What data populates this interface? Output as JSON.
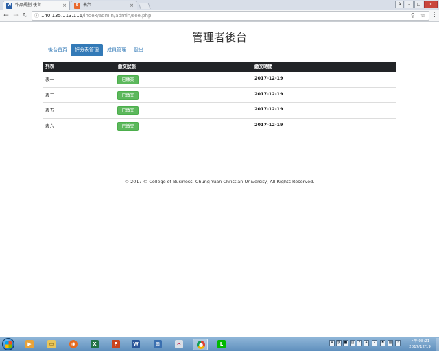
{
  "browser": {
    "tabs": [
      {
        "title": "作品規劃-後台",
        "favicon": "bar-chart-icon",
        "active": true
      },
      {
        "title": "表六",
        "favicon": "html-icon",
        "active": false
      }
    ],
    "url_host": "140.135.113.116",
    "url_path": "/index/admin/admin/see.php"
  },
  "page": {
    "title": "管理者後台",
    "nav": [
      {
        "label": "後台首頁",
        "active": false
      },
      {
        "label": "評分表管理",
        "active": true
      },
      {
        "label": "成員管理",
        "active": false
      },
      {
        "label": "登出",
        "active": false
      }
    ],
    "table": {
      "headers": [
        "列表",
        "繳交狀態",
        "繳交時間"
      ],
      "rows": [
        {
          "name": "表一",
          "status": "已繳交",
          "date": "2017-12-19"
        },
        {
          "name": "表三",
          "status": "已繳交",
          "date": "2017-12-19"
        },
        {
          "name": "表五",
          "status": "已繳交",
          "date": "2017-12-19"
        },
        {
          "name": "表六",
          "status": "已繳交",
          "date": "2017-12-19"
        }
      ]
    },
    "footer": "© 2017 © College of Business, Chung Yuan Christian University, All Rights Reserved."
  },
  "taskbar": {
    "clock_time": "下午 08:21",
    "clock_date": "2017/12/19",
    "apps": [
      "media-player-icon",
      "file-explorer-icon",
      "firefox-icon",
      "excel-icon",
      "powerpoint-icon",
      "word-icon",
      "network-tool-icon",
      "paint-tool-icon",
      "chrome-icon",
      "line-icon"
    ]
  },
  "colors": {
    "primary": "#337ab7",
    "success": "#5cb85c",
    "table_header": "#222427"
  }
}
